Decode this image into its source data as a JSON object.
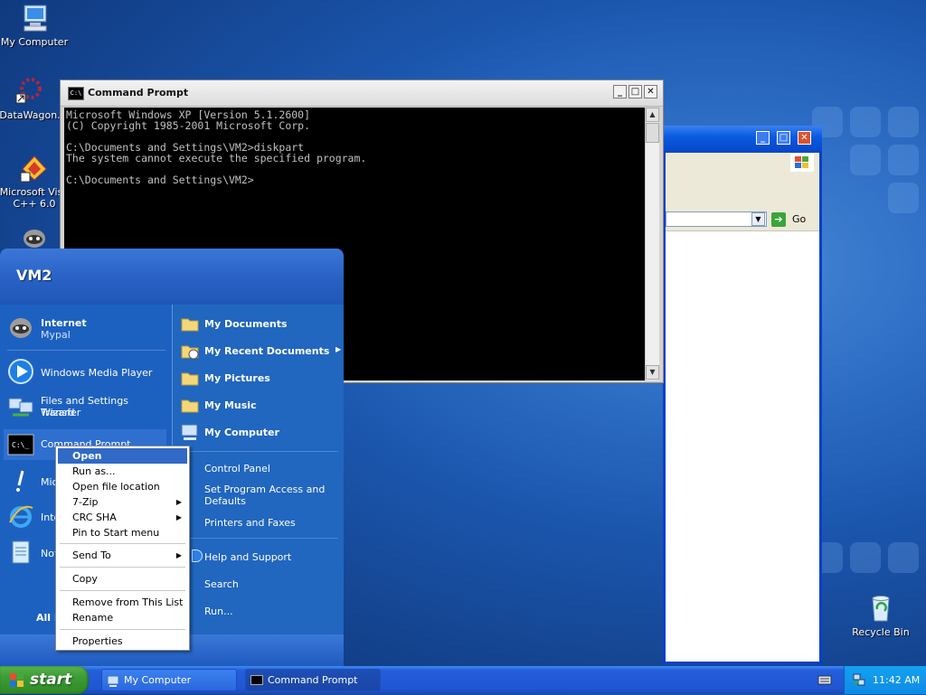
{
  "desktop": {
    "icons": [
      {
        "label": "My Computer"
      },
      {
        "label": "DataWagon."
      },
      {
        "label_line1": "Microsoft Visu",
        "label_line2": "C++ 6.0"
      },
      {
        "label": "Recycle Bin"
      }
    ]
  },
  "explorer_window": {
    "go_label": "Go"
  },
  "cmd_window": {
    "title": "Command Prompt",
    "icon_text": "C:\\",
    "console_lines": [
      "Microsoft Windows XP [Version 5.1.2600]",
      "(C) Copyright 1985-2001 Microsoft Corp.",
      "",
      "C:\\Documents and Settings\\VM2>diskpart",
      "The system cannot execute the specified program.",
      "",
      "C:\\Documents and Settings\\VM2>"
    ]
  },
  "start_menu": {
    "user": "VM2",
    "pinned": [
      {
        "label": "Internet",
        "sub": "Mypal"
      }
    ],
    "recent": [
      {
        "label": "Windows Media Player"
      },
      {
        "label_line1": "Files and Settings Transfer",
        "label_line2": "Wizard"
      },
      {
        "label": "Command Prompt"
      },
      {
        "label": "Mic"
      },
      {
        "label": "Inte"
      },
      {
        "label": "Not"
      }
    ],
    "all_programs": "All P",
    "right": [
      {
        "label": "My Documents"
      },
      {
        "label": "My Recent Documents"
      },
      {
        "label": "My Pictures"
      },
      {
        "label": "My Music"
      },
      {
        "label": "My Computer"
      },
      {
        "label": "Control Panel"
      },
      {
        "label_line1": "Set Program Access and",
        "label_line2": "Defaults"
      },
      {
        "label": "Printers and Faxes"
      },
      {
        "label": "Help and Support"
      },
      {
        "label": "Search"
      },
      {
        "label": "Run..."
      }
    ]
  },
  "context_menu": {
    "items": [
      {
        "label": "Open"
      },
      {
        "label": "Run as..."
      },
      {
        "label": "Open file location"
      },
      {
        "label": "7-Zip"
      },
      {
        "label": "CRC SHA"
      },
      {
        "label": "Pin to Start menu"
      },
      {
        "label": "Send To"
      },
      {
        "label": "Copy"
      },
      {
        "label": "Remove from This List"
      },
      {
        "label": "Rename"
      },
      {
        "label": "Properties"
      }
    ]
  },
  "taskbar": {
    "start_label": "start",
    "buttons": [
      {
        "label": "My Computer"
      },
      {
        "label": "Command Prompt"
      }
    ],
    "clock": "11:42 AM"
  }
}
